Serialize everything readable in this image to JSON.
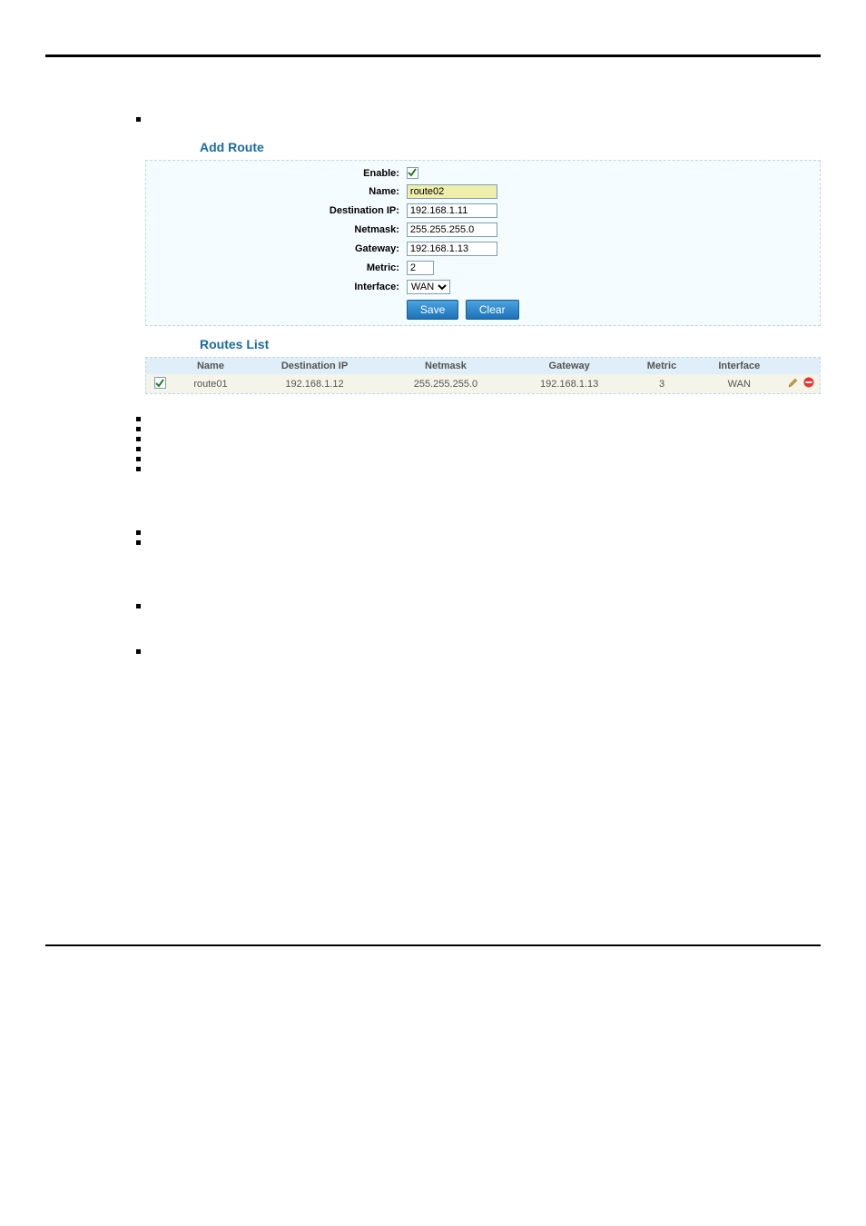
{
  "sections": {
    "add_route": {
      "title": "Add Route",
      "fields": {
        "enable_label": "Enable:",
        "name_label": "Name:",
        "name_value": "route02",
        "dest_label": "Destination IP:",
        "dest_value": "192.168.1.11",
        "netmask_label": "Netmask:",
        "netmask_value": "255.255.255.0",
        "gateway_label": "Gateway:",
        "gateway_value": "192.168.1.13",
        "metric_label": "Metric:",
        "metric_value": "2",
        "interface_label": "Interface:",
        "interface_value": "WAN"
      },
      "buttons": {
        "save": "Save",
        "clear": "Clear"
      }
    },
    "routes_list": {
      "title": "Routes List",
      "headers": {
        "name": "Name",
        "dest": "Destination IP",
        "netmask": "Netmask",
        "gateway": "Gateway",
        "metric": "Metric",
        "interface": "Interface"
      },
      "row": {
        "name": "route01",
        "dest": "192.168.1.12",
        "netmask": "255.255.255.0",
        "gateway": "192.168.1.13",
        "metric": "3",
        "interface": "WAN"
      }
    }
  }
}
